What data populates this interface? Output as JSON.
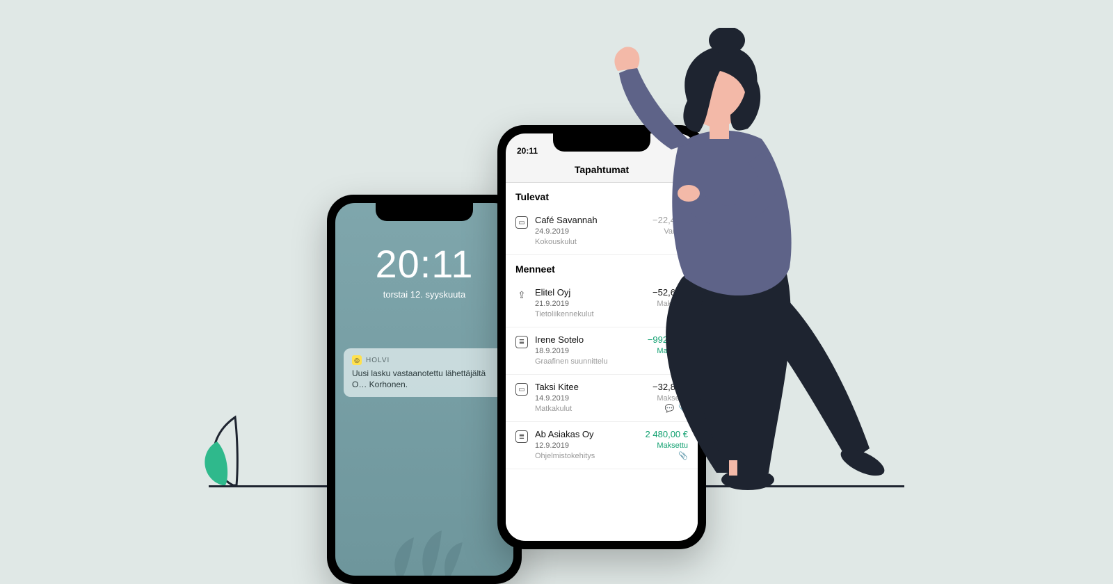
{
  "lock": {
    "time": "20:11",
    "date": "torstai 12. syyskuuta",
    "notification": {
      "app": "HOLVI",
      "body": "Uusi lasku vastaanotettu lähettäjältä O… Korhonen."
    }
  },
  "tx": {
    "statusTime": "20:11",
    "header": "Tapahtumat",
    "sections": {
      "upcoming": "Tulevat",
      "past": "Menneet"
    },
    "upcoming": [
      {
        "name": "Café Savannah",
        "date": "24.9.2019",
        "category": "Kokouskulut",
        "amount": "−22,40 €",
        "status": "Varattu",
        "style": "dim"
      }
    ],
    "past": [
      {
        "name": "Elitel Oyj",
        "date": "21.9.2019",
        "category": "Tietoliikennekulut",
        "amount": "−52,60 €",
        "status": "Maksettu",
        "style": "neg",
        "icon": "upload"
      },
      {
        "name": "Irene Sotelo",
        "date": "18.9.2019",
        "category": "Graafinen suunnittelu",
        "amount": "−992,00 €",
        "status": "Maksettu",
        "style": "pos",
        "attach": true
      },
      {
        "name": "Taksi Kitee",
        "date": "14.9.2019",
        "category": "Matkakulut",
        "amount": "−32,87 €",
        "status": "Maksettu",
        "style": "neg",
        "attach": true,
        "comment": true
      },
      {
        "name": "Ab Asiakas Oy",
        "date": "12.9.2019",
        "category": "Ohjelmistokehitys",
        "amount": "2 480,00 €",
        "status": "Maksettu",
        "style": "pos",
        "attach": true
      }
    ]
  }
}
